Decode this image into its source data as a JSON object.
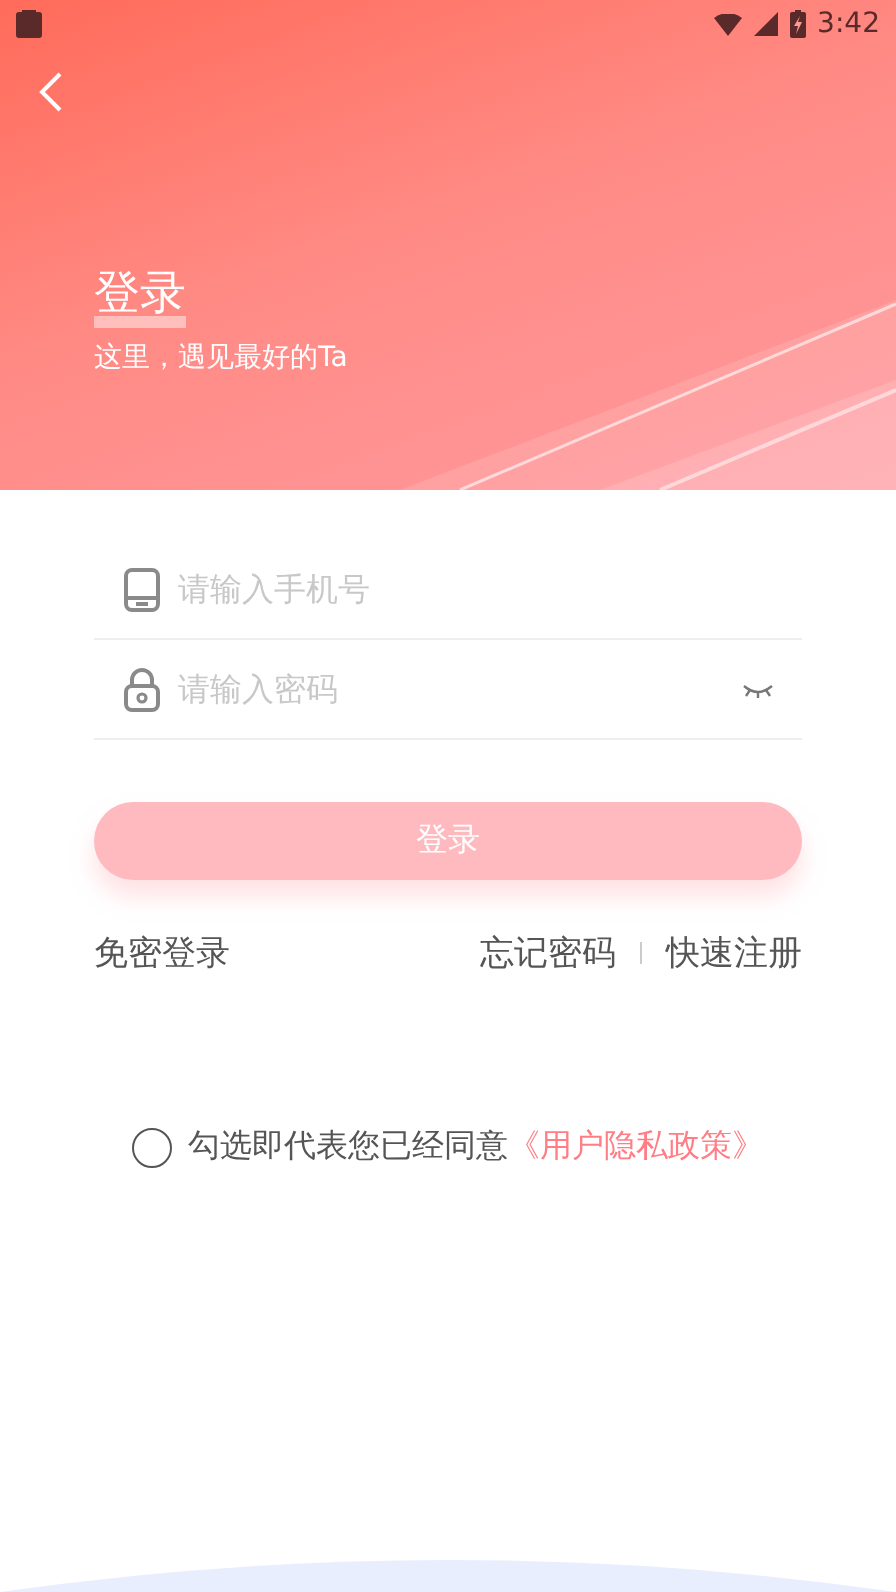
{
  "status_bar": {
    "time": "3:42"
  },
  "header": {
    "title": "登录",
    "subtitle": "这里，遇见最好的Ta"
  },
  "fields": [
    {
      "kind": "phone",
      "placeholder": "请输入手机号"
    },
    {
      "kind": "password",
      "placeholder": "请输入密码"
    }
  ],
  "login_button": {
    "label": "登录"
  },
  "links": {
    "left": "免密登录",
    "right": [
      "忘记密码",
      "快速注册"
    ]
  },
  "agreement": {
    "checked": false,
    "text": "勾选即代表您已经同意",
    "link": "《用户隐私政策》"
  }
}
